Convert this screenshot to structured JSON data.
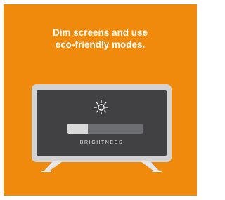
{
  "headline": {
    "line1": "Dim screens and use",
    "line2": "eco-friendly modes."
  },
  "tv": {
    "icon": "sun-brightness-icon",
    "brightness_label": "BRIGHTNESS",
    "brightness_level": 0.27
  },
  "colors": {
    "background": "#f08a0c",
    "tv_bezel": "#d3d3d3",
    "screen": "#414042",
    "slider_track": "#6d6e71",
    "slider_fill": "#d9d9d9"
  }
}
